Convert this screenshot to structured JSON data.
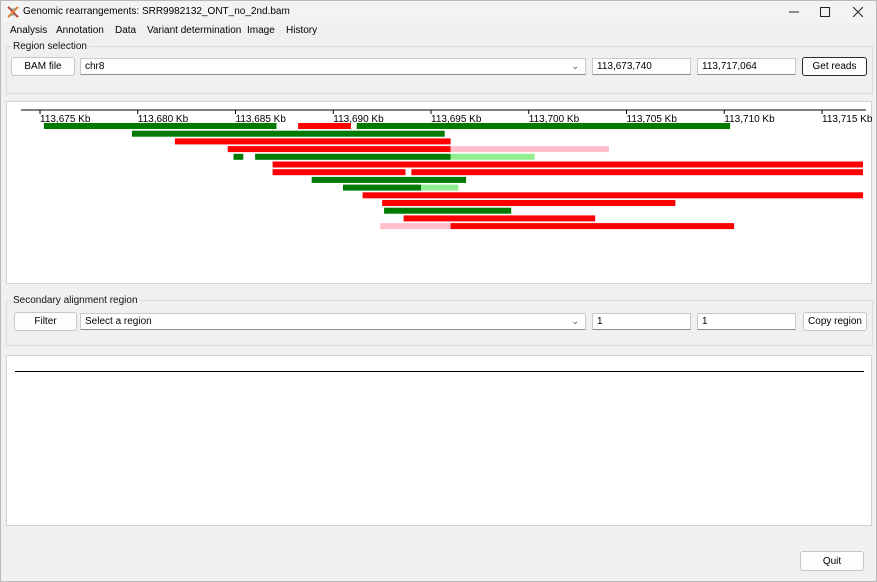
{
  "window": {
    "title": "Genomic rearrangements: SRR9982132_ONT_no_2nd.bam"
  },
  "menu": [
    "Analysis",
    "Annotation",
    "Data",
    "Variant determination",
    "Image",
    "History"
  ],
  "region_selection": {
    "label": "Region selection",
    "bam_button": "BAM file",
    "chromosome": "chr8",
    "start": "113,673,740",
    "end": "113,717,064",
    "get_reads_button": "Get reads"
  },
  "secondary_region": {
    "label": "Secondary alignment region",
    "filter_button": "Filter",
    "region_placeholder": "Select a region",
    "start": "1",
    "end": "1",
    "copy_button": "Copy region"
  },
  "quit_button": "Quit",
  "colors": {
    "forward_strand": "#007a00",
    "forward_light": "#90ee90",
    "reverse_strand": "#ff0000",
    "reverse_light": "#ffc0cb"
  },
  "chart_data": {
    "type": "alignment-track",
    "x_unit": "Kb",
    "xlim": [
      113673.7,
      113717.1
    ],
    "ticks": [
      113675,
      113680,
      113685,
      113690,
      113695,
      113700,
      113705,
      113710,
      113715
    ],
    "tick_labels": [
      "113,675 Kb",
      "113,680 Kb",
      "113,685 Kb",
      "113,690 Kb",
      "113,695 Kb",
      "113,700 Kb",
      "113,705 Kb",
      "113,710 Kb",
      "113,715 Kb"
    ],
    "reads": [
      [
        {
          "start": 113675.2,
          "end": 113687.1,
          "color": "forward_strand"
        },
        {
          "start": 113688.2,
          "end": 113690.9,
          "color": "reverse_strand"
        },
        {
          "start": 113691.2,
          "end": 113710.3,
          "color": "forward_strand"
        }
      ],
      [
        {
          "start": 113679.7,
          "end": 113695.7,
          "color": "forward_strand"
        }
      ],
      [
        {
          "start": 113681.9,
          "end": 113696.0,
          "color": "reverse_strand"
        }
      ],
      [
        {
          "start": 113684.6,
          "end": 113696.0,
          "color": "reverse_strand"
        },
        {
          "start": 113696.0,
          "end": 113704.1,
          "color": "reverse_light"
        }
      ],
      [
        {
          "start": 113684.9,
          "end": 113685.4,
          "color": "forward_strand"
        },
        {
          "start": 113686.0,
          "end": 113696.0,
          "color": "forward_strand"
        },
        {
          "start": 113696.0,
          "end": 113700.3,
          "color": "forward_light"
        }
      ],
      [
        {
          "start": 113686.9,
          "end": 113717.1,
          "color": "reverse_strand"
        }
      ],
      [
        {
          "start": 113686.9,
          "end": 113693.7,
          "color": "reverse_strand"
        },
        {
          "start": 113694.0,
          "end": 113717.1,
          "color": "reverse_strand"
        }
      ],
      [
        {
          "start": 113688.9,
          "end": 113696.8,
          "color": "forward_strand"
        }
      ],
      [
        {
          "start": 113690.5,
          "end": 113694.5,
          "color": "forward_strand"
        },
        {
          "start": 113694.5,
          "end": 113696.4,
          "color": "forward_light"
        }
      ],
      [
        {
          "start": 113691.5,
          "end": 113717.1,
          "color": "reverse_strand"
        }
      ],
      [
        {
          "start": 113692.5,
          "end": 113707.5,
          "color": "reverse_strand"
        }
      ],
      [
        {
          "start": 113692.6,
          "end": 113699.1,
          "color": "forward_strand"
        }
      ],
      [
        {
          "start": 113693.6,
          "end": 113703.4,
          "color": "reverse_strand"
        }
      ],
      [
        {
          "start": 113692.4,
          "end": 113696.0,
          "color": "reverse_light"
        },
        {
          "start": 113696.0,
          "end": 113710.5,
          "color": "reverse_strand"
        }
      ]
    ]
  }
}
